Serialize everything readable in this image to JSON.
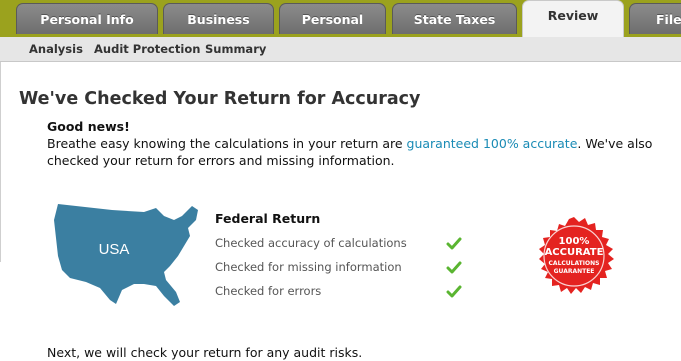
{
  "tabs": [
    {
      "label": "Personal Info"
    },
    {
      "label": "Business"
    },
    {
      "label": "Personal"
    },
    {
      "label": "State Taxes"
    },
    {
      "label": "Review"
    },
    {
      "label": "File"
    }
  ],
  "subnav": [
    {
      "label": "Analysis"
    },
    {
      "label": "Audit Protection"
    },
    {
      "label": "Summary"
    }
  ],
  "main": {
    "title": "We've Checked Your Return for Accuracy",
    "good_news": "Good news!",
    "para_part1": "Breathe easy knowing the calculations in your return are ",
    "para_link": "guaranteed 100% accurate",
    "para_part2": ". We've also checked your return for errors and missing information.",
    "map_label": "USA",
    "federal_title": "Federal Return",
    "checks": [
      {
        "label": "Checked accuracy of calculations"
      },
      {
        "label": "Checked for missing information"
      },
      {
        "label": "Checked for errors"
      }
    ],
    "seal": {
      "line1": "100%",
      "line2": "ACCURATE",
      "line3": "CALCULATIONS",
      "line4": "GUARANTEE"
    },
    "next_text": "Next, we will check your return for any audit risks."
  },
  "colors": {
    "tabbar_bg": "#9ba21e",
    "link": "#1a8bb5",
    "map": "#3b7fa1",
    "check": "#5ab531",
    "seal": "#e42320"
  }
}
